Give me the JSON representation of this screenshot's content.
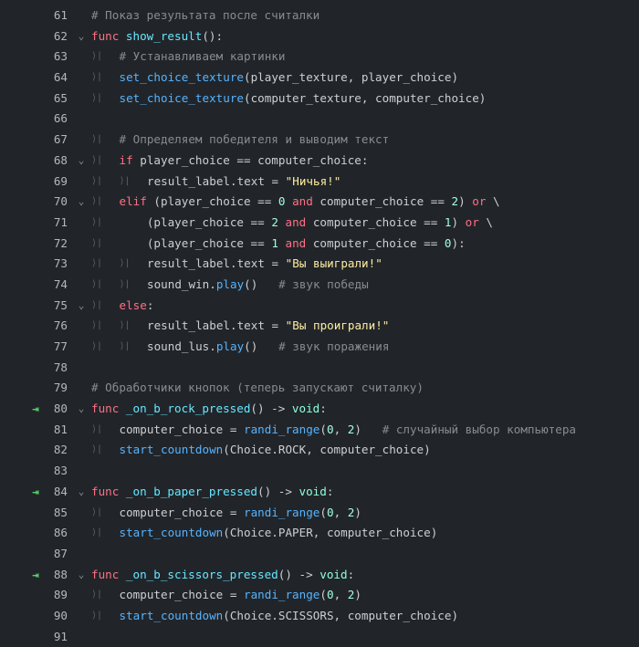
{
  "editor": {
    "icons": {
      "fold": "chevron-down-icon",
      "tab": "tab-marker-icon",
      "signal": "signal-connection-icon"
    },
    "colors": {
      "background": "#212529",
      "comment": "#878c93",
      "keyword": "#ff7085",
      "function_def": "#66e6ff",
      "function_call": "#57b3ff",
      "string": "#ffeda1",
      "number": "#a1ffe0",
      "signal": "#55d46a"
    },
    "glyphs": {
      "fold": "⌄",
      "tab": "⟩|",
      "signal": "⇥"
    },
    "lines": [
      {
        "num": "61",
        "fold": false,
        "signal": false,
        "tabs": 0,
        "tokens": [
          {
            "t": "# Показ результата после считалки",
            "c": "comment"
          }
        ]
      },
      {
        "num": "62",
        "fold": true,
        "signal": false,
        "tabs": 0,
        "tokens": [
          {
            "t": "func ",
            "c": "kw"
          },
          {
            "t": "show_result",
            "c": "fn"
          },
          {
            "t": "():",
            "c": "var"
          }
        ]
      },
      {
        "num": "63",
        "fold": false,
        "signal": false,
        "tabs": 1,
        "tokens": [
          {
            "t": "# Устанавливаем картинки",
            "c": "comment"
          }
        ]
      },
      {
        "num": "64",
        "fold": false,
        "signal": false,
        "tabs": 1,
        "tokens": [
          {
            "t": "set_choice_texture",
            "c": "call"
          },
          {
            "t": "(player_texture, player_choice)",
            "c": "var"
          }
        ]
      },
      {
        "num": "65",
        "fold": false,
        "signal": false,
        "tabs": 1,
        "tokens": [
          {
            "t": "set_choice_texture",
            "c": "call"
          },
          {
            "t": "(computer_texture, computer_choice)",
            "c": "var"
          }
        ]
      },
      {
        "num": "66",
        "fold": false,
        "signal": false,
        "tabs": 0,
        "tokens": []
      },
      {
        "num": "67",
        "fold": false,
        "signal": false,
        "tabs": 1,
        "tokens": [
          {
            "t": "# Определяем победителя и выводим текст",
            "c": "comment"
          }
        ]
      },
      {
        "num": "68",
        "fold": true,
        "signal": false,
        "tabs": 1,
        "tokens": [
          {
            "t": "if ",
            "c": "kw"
          },
          {
            "t": "player_choice == computer_choice:",
            "c": "var"
          }
        ]
      },
      {
        "num": "69",
        "fold": false,
        "signal": false,
        "tabs": 2,
        "tokens": [
          {
            "t": "result_label.text = ",
            "c": "var"
          },
          {
            "t": "\"Ничья!\"",
            "c": "str"
          }
        ]
      },
      {
        "num": "70",
        "fold": true,
        "signal": false,
        "tabs": 1,
        "tokens": [
          {
            "t": "elif ",
            "c": "kw"
          },
          {
            "t": "(player_choice == ",
            "c": "var"
          },
          {
            "t": "0",
            "c": "num"
          },
          {
            "t": " and ",
            "c": "kw"
          },
          {
            "t": "computer_choice == ",
            "c": "var"
          },
          {
            "t": "2",
            "c": "num"
          },
          {
            "t": ") ",
            "c": "var"
          },
          {
            "t": "or",
            "c": "kw"
          },
          {
            "t": " \\",
            "c": "var"
          }
        ]
      },
      {
        "num": "71",
        "fold": false,
        "signal": false,
        "tabs": 1,
        "tokens": [
          {
            "t": "    (player_choice == ",
            "c": "var"
          },
          {
            "t": "2",
            "c": "num"
          },
          {
            "t": " and ",
            "c": "kw"
          },
          {
            "t": "computer_choice == ",
            "c": "var"
          },
          {
            "t": "1",
            "c": "num"
          },
          {
            "t": ") ",
            "c": "var"
          },
          {
            "t": "or",
            "c": "kw"
          },
          {
            "t": " \\",
            "c": "var"
          }
        ]
      },
      {
        "num": "72",
        "fold": false,
        "signal": false,
        "tabs": 1,
        "tokens": [
          {
            "t": "    (player_choice == ",
            "c": "var"
          },
          {
            "t": "1",
            "c": "num"
          },
          {
            "t": " and ",
            "c": "kw"
          },
          {
            "t": "computer_choice == ",
            "c": "var"
          },
          {
            "t": "0",
            "c": "num"
          },
          {
            "t": "):",
            "c": "var"
          }
        ]
      },
      {
        "num": "73",
        "fold": false,
        "signal": false,
        "tabs": 2,
        "tokens": [
          {
            "t": "result_label.text = ",
            "c": "var"
          },
          {
            "t": "\"Вы выиграли!\"",
            "c": "str"
          }
        ]
      },
      {
        "num": "74",
        "fold": false,
        "signal": false,
        "tabs": 2,
        "tokens": [
          {
            "t": "sound_win.",
            "c": "var"
          },
          {
            "t": "play",
            "c": "call"
          },
          {
            "t": "()   ",
            "c": "var"
          },
          {
            "t": "# звук победы",
            "c": "comment"
          }
        ]
      },
      {
        "num": "75",
        "fold": true,
        "signal": false,
        "tabs": 1,
        "tokens": [
          {
            "t": "else",
            "c": "kw"
          },
          {
            "t": ":",
            "c": "var"
          }
        ]
      },
      {
        "num": "76",
        "fold": false,
        "signal": false,
        "tabs": 2,
        "tokens": [
          {
            "t": "result_label.text = ",
            "c": "var"
          },
          {
            "t": "\"Вы проиграли!\"",
            "c": "str"
          }
        ]
      },
      {
        "num": "77",
        "fold": false,
        "signal": false,
        "tabs": 2,
        "tokens": [
          {
            "t": "sound_lus.",
            "c": "var"
          },
          {
            "t": "play",
            "c": "call"
          },
          {
            "t": "()   ",
            "c": "var"
          },
          {
            "t": "# звук поражения",
            "c": "comment"
          }
        ]
      },
      {
        "num": "78",
        "fold": false,
        "signal": false,
        "tabs": 0,
        "tokens": []
      },
      {
        "num": "79",
        "fold": false,
        "signal": false,
        "tabs": 0,
        "tokens": [
          {
            "t": "# Обработчики кнопок (теперь запускают считалку)",
            "c": "comment"
          }
        ]
      },
      {
        "num": "80",
        "fold": true,
        "signal": true,
        "tabs": 0,
        "tokens": [
          {
            "t": "func ",
            "c": "kw"
          },
          {
            "t": "_on_b_rock_pressed",
            "c": "fn"
          },
          {
            "t": "() -> ",
            "c": "var"
          },
          {
            "t": "void",
            "c": "type"
          },
          {
            "t": ":",
            "c": "var"
          }
        ]
      },
      {
        "num": "81",
        "fold": false,
        "signal": false,
        "tabs": 1,
        "tokens": [
          {
            "t": "computer_choice = ",
            "c": "var"
          },
          {
            "t": "randi_range",
            "c": "call"
          },
          {
            "t": "(",
            "c": "var"
          },
          {
            "t": "0",
            "c": "num"
          },
          {
            "t": ", ",
            "c": "var"
          },
          {
            "t": "2",
            "c": "num"
          },
          {
            "t": ")   ",
            "c": "var"
          },
          {
            "t": "# случайный выбор компьютера",
            "c": "comment"
          }
        ]
      },
      {
        "num": "82",
        "fold": false,
        "signal": false,
        "tabs": 1,
        "tokens": [
          {
            "t": "start_countdown",
            "c": "call"
          },
          {
            "t": "(Choice.ROCK, computer_choice)",
            "c": "var"
          }
        ]
      },
      {
        "num": "83",
        "fold": false,
        "signal": false,
        "tabs": 0,
        "tokens": []
      },
      {
        "num": "84",
        "fold": true,
        "signal": true,
        "tabs": 0,
        "tokens": [
          {
            "t": "func ",
            "c": "kw"
          },
          {
            "t": "_on_b_paper_pressed",
            "c": "fn"
          },
          {
            "t": "() -> ",
            "c": "var"
          },
          {
            "t": "void",
            "c": "type"
          },
          {
            "t": ":",
            "c": "var"
          }
        ]
      },
      {
        "num": "85",
        "fold": false,
        "signal": false,
        "tabs": 1,
        "tokens": [
          {
            "t": "computer_choice = ",
            "c": "var"
          },
          {
            "t": "randi_range",
            "c": "call"
          },
          {
            "t": "(",
            "c": "var"
          },
          {
            "t": "0",
            "c": "num"
          },
          {
            "t": ", ",
            "c": "var"
          },
          {
            "t": "2",
            "c": "num"
          },
          {
            "t": ")",
            "c": "var"
          }
        ]
      },
      {
        "num": "86",
        "fold": false,
        "signal": false,
        "tabs": 1,
        "tokens": [
          {
            "t": "start_countdown",
            "c": "call"
          },
          {
            "t": "(Choice.PAPER, computer_choice)",
            "c": "var"
          }
        ]
      },
      {
        "num": "87",
        "fold": false,
        "signal": false,
        "tabs": 0,
        "tokens": []
      },
      {
        "num": "88",
        "fold": true,
        "signal": true,
        "tabs": 0,
        "tokens": [
          {
            "t": "func ",
            "c": "kw"
          },
          {
            "t": "_on_b_scissors_pressed",
            "c": "fn"
          },
          {
            "t": "() -> ",
            "c": "var"
          },
          {
            "t": "void",
            "c": "type"
          },
          {
            "t": ":",
            "c": "var"
          }
        ]
      },
      {
        "num": "89",
        "fold": false,
        "signal": false,
        "tabs": 1,
        "tokens": [
          {
            "t": "computer_choice = ",
            "c": "var"
          },
          {
            "t": "randi_range",
            "c": "call"
          },
          {
            "t": "(",
            "c": "var"
          },
          {
            "t": "0",
            "c": "num"
          },
          {
            "t": ", ",
            "c": "var"
          },
          {
            "t": "2",
            "c": "num"
          },
          {
            "t": ")",
            "c": "var"
          }
        ]
      },
      {
        "num": "90",
        "fold": false,
        "signal": false,
        "tabs": 1,
        "tokens": [
          {
            "t": "start_countdown",
            "c": "call"
          },
          {
            "t": "(Choice.SCISSORS, computer_choice)",
            "c": "var"
          }
        ]
      },
      {
        "num": "91",
        "fold": false,
        "signal": false,
        "tabs": 0,
        "tokens": []
      }
    ]
  }
}
